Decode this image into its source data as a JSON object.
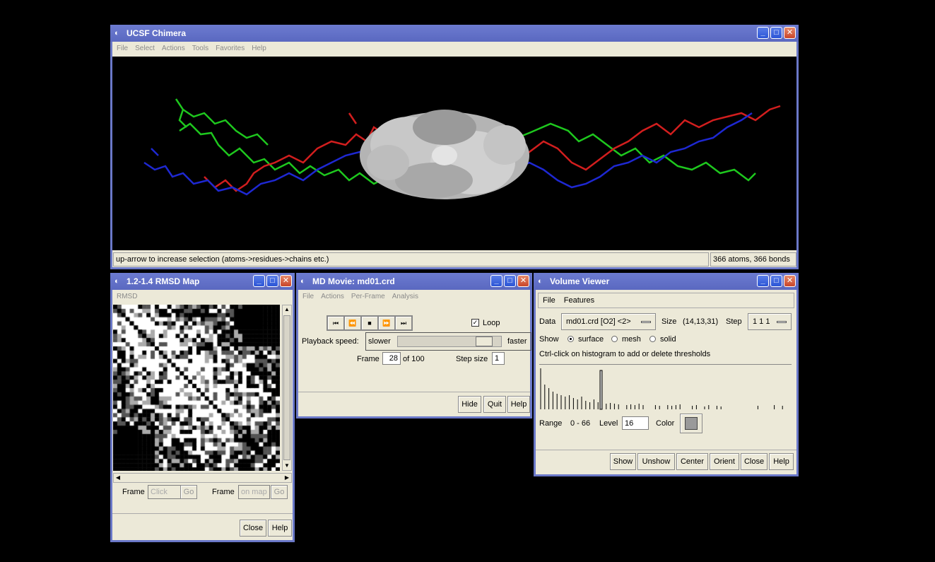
{
  "chimera": {
    "title": "UCSF Chimera",
    "menus": [
      "File",
      "Select",
      "Actions",
      "Tools",
      "Favorites",
      "Help"
    ],
    "status_left": "up-arrow to increase selection (atoms->residues->chains etc.)",
    "status_right": "366 atoms, 366 bonds"
  },
  "rmsd": {
    "title": "1.2-1.4 RMSD Map",
    "menu_label": "RMSD",
    "frame_label_1": "Frame",
    "frame_placeholder_1": "Click",
    "go_label_1": "Go",
    "frame_label_2": "Frame",
    "frame_placeholder_2": "on map",
    "go_label_2": "Go",
    "close_label": "Close",
    "help_label": "Help"
  },
  "md_movie": {
    "title": "MD Movie: md01.crd",
    "menus": [
      "File",
      "Actions",
      "Per-Frame",
      "Analysis"
    ],
    "loop_label": "Loop",
    "loop_checked": true,
    "playback_label": "Playback speed:",
    "slower_label": "slower",
    "faster_label": "faster",
    "speed_fraction": 0.9,
    "frame_label": "Frame",
    "frame_value": "28",
    "of_label": "of 100",
    "step_label": "Step size",
    "step_value": "1",
    "hide_label": "Hide",
    "quit_label": "Quit",
    "help_label": "Help"
  },
  "volume": {
    "title": "Volume Viewer",
    "menus": [
      "File",
      "Features"
    ],
    "data_label": "Data",
    "data_value": "md01.crd [O2] <2>",
    "size_label": "Size",
    "size_value": "(14,13,31)",
    "step_label": "Step",
    "step_value": "1 1 1",
    "show_label": "Show",
    "show_options": [
      "surface",
      "mesh",
      "solid"
    ],
    "show_selected": "surface",
    "hint": "Ctrl-click on histogram to add or delete thresholds",
    "range_label": "Range",
    "range_value": "0 - 66",
    "level_label": "Level",
    "level_value": "16",
    "color_label": "Color",
    "swatch_color": "#9a9a9a",
    "buttons": [
      "Show",
      "Unshow",
      "Center",
      "Orient",
      "Close",
      "Help"
    ]
  }
}
